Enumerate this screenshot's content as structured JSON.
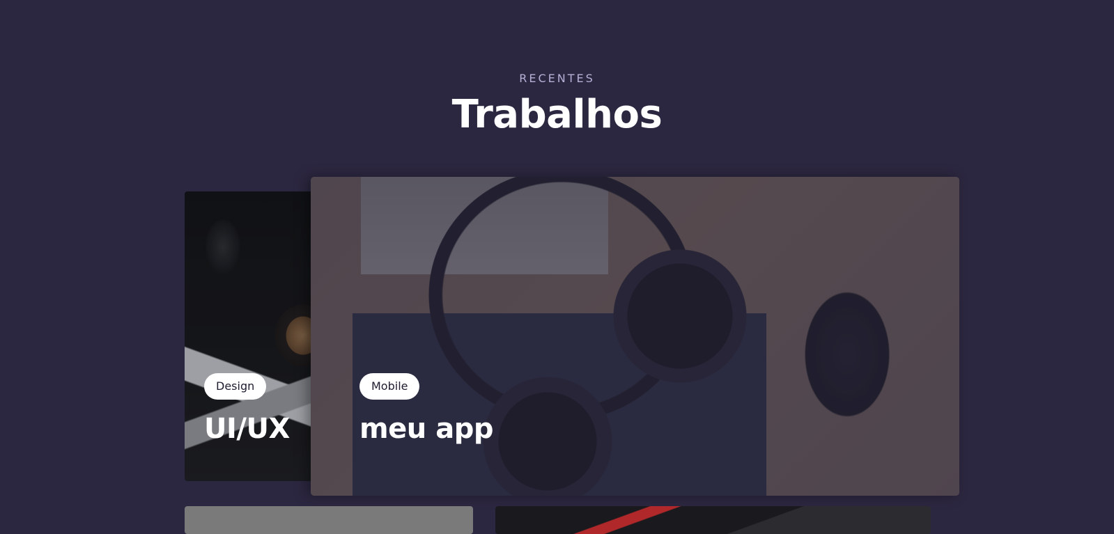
{
  "section": {
    "eyebrow": "RECENTES",
    "title": "Trabalhos"
  },
  "projects": [
    {
      "tag": "Design",
      "title": "UI/UX",
      "image": "dark desk with mouse, coffee and phone"
    },
    {
      "tag": "Mobile",
      "title": "meu app",
      "image": "headphones on keyboard with mouse and plant"
    }
  ],
  "colors": {
    "background": "#2c2740",
    "eyebrow": "#b7b0d6",
    "title": "#ffffff",
    "tag_background": "#ffffff",
    "tag_text": "#1f1b2e"
  }
}
